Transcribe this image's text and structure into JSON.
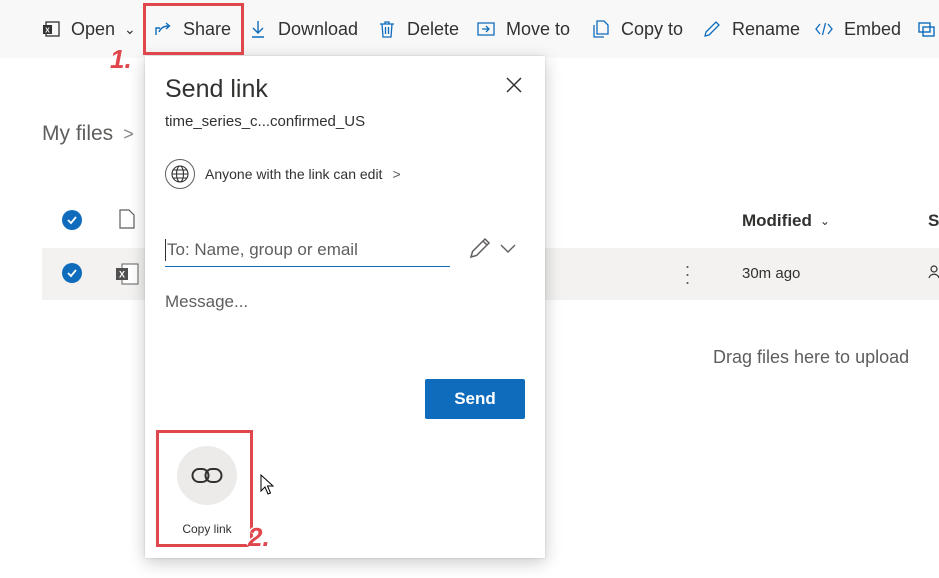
{
  "toolbar": {
    "open_label": "Open",
    "share_label": "Share",
    "download_label": "Download",
    "delete_label": "Delete",
    "move_label": "Move to",
    "copy_label": "Copy to",
    "rename_label": "Rename",
    "embed_label": "Embed"
  },
  "breadcrumb": {
    "label": "My files"
  },
  "list": {
    "modified_header": "Modified",
    "s_header": "S",
    "selected_row": {
      "modified": "30m ago"
    },
    "drag_hint": "Drag files here to upload"
  },
  "dialog": {
    "title": "Send link",
    "filename": "time_series_c...confirmed_US",
    "permission": "Anyone with the link can edit",
    "to_placeholder": "To: Name, group or email",
    "message_placeholder": "Message...",
    "send_label": "Send",
    "copy_link_label": "Copy link"
  },
  "annotations": {
    "step1": "1.",
    "step2": "2."
  },
  "colors": {
    "accent": "#0f6cbd",
    "annotation": "#e0474c"
  }
}
